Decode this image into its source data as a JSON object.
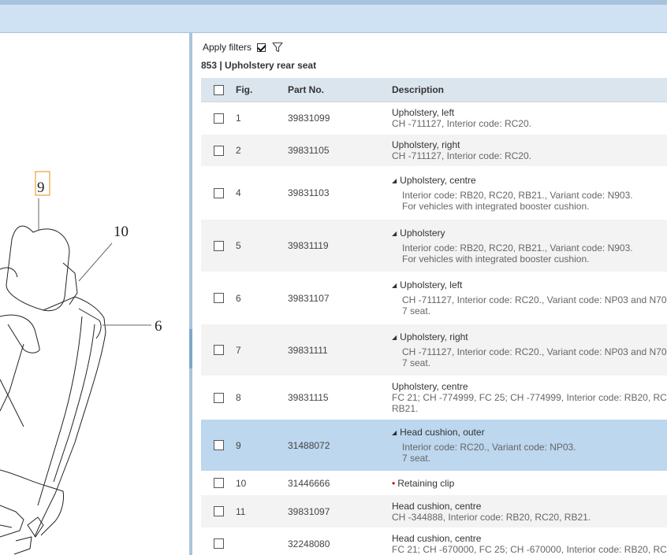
{
  "filter": {
    "apply_label": "Apply filters",
    "checked": true,
    "icon": "funnel-icon"
  },
  "section": {
    "title": "853  |  Upholstery rear seat"
  },
  "diagram": {
    "callouts": [
      "9",
      "10",
      "6"
    ]
  },
  "table": {
    "headers": {
      "fig": "Fig.",
      "part": "Part No.",
      "desc": "Description"
    },
    "rows": [
      {
        "fig": "1",
        "part": "39831099",
        "title": "Upholstery, left",
        "lines": [
          "CH -711127, Interior code: RC20."
        ],
        "style": "plain"
      },
      {
        "fig": "2",
        "part": "39831105",
        "title": "Upholstery, right",
        "lines": [
          "CH -711127, Interior code: RC20."
        ],
        "style": "plain"
      },
      {
        "fig": "4",
        "part": "39831103",
        "title": "Upholstery, centre",
        "lines": [
          "Interior code: RB20, RC20, RB21., Variant code: N903.",
          "For vehicles with integrated booster cushion."
        ],
        "style": "expand"
      },
      {
        "fig": "5",
        "part": "39831119",
        "title": "Upholstery",
        "lines": [
          "Interior code: RB20, RC20, RB21., Variant code: N903.",
          "For vehicles with integrated booster cushion."
        ],
        "style": "expand"
      },
      {
        "fig": "6",
        "part": "39831107",
        "title": "Upholstery, left",
        "lines": [
          "CH -711127, Interior code: RC20., Variant code: NP03 and N70",
          "7 seat."
        ],
        "style": "expand"
      },
      {
        "fig": "7",
        "part": "39831111",
        "title": "Upholstery, right",
        "lines": [
          "CH -711127, Interior code: RC20., Variant code: NP03 and N70",
          "7 seat."
        ],
        "style": "expand"
      },
      {
        "fig": "8",
        "part": "39831115",
        "title": "Upholstery, centre",
        "lines": [
          "FC 21; CH -774999, FC 25; CH -774999, Interior code: RB20, RC",
          "RB21."
        ],
        "style": "plain"
      },
      {
        "fig": "9",
        "part": "31488072",
        "title": "Head cushion, outer",
        "lines": [
          "Interior code: RC20., Variant code: NP03.",
          "7 seat."
        ],
        "style": "expand",
        "selected": true
      },
      {
        "fig": "10",
        "part": "31446666",
        "title": "Retaining clip",
        "lines": [],
        "style": "bullet"
      },
      {
        "fig": "11",
        "part": "39831097",
        "title": "Head cushion, centre",
        "lines": [
          "CH -344888, Interior code: RB20, RC20, RB21."
        ],
        "style": "plain"
      },
      {
        "fig": "",
        "part": "32248080",
        "title": "Head cushion, centre",
        "lines": [
          "FC 21; CH -670000, FC 25; CH -670000, Interior code: RB20, RC"
        ],
        "style": "plain"
      }
    ]
  }
}
